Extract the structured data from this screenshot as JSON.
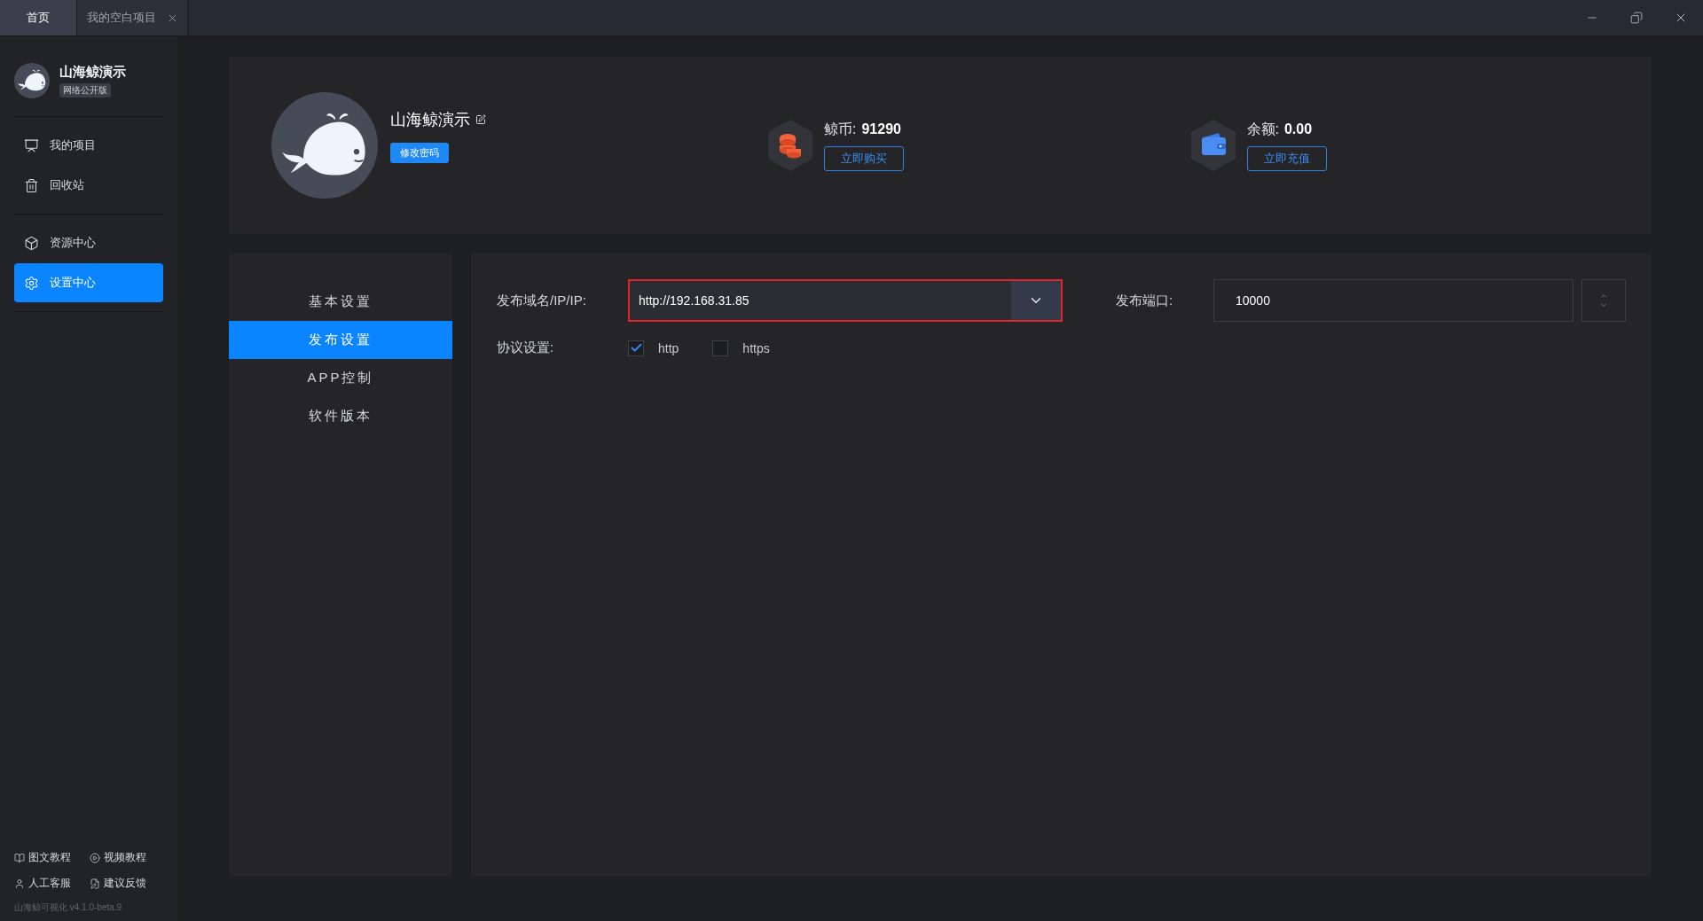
{
  "tabs": [
    {
      "label": "首页",
      "selected": true,
      "closable": false
    },
    {
      "label": "我的空白项目",
      "selected": false,
      "closable": true
    }
  ],
  "sidebar": {
    "brand": {
      "name": "山海鲸演示",
      "edition": "网络公开版"
    },
    "groups": [
      [
        {
          "kind": "projects",
          "label": "我的项目",
          "selected": false
        },
        {
          "kind": "trash",
          "label": "回收站",
          "selected": false
        }
      ],
      [
        {
          "kind": "resources",
          "label": "资源中心",
          "selected": false
        },
        {
          "kind": "settings",
          "label": "设置中心",
          "selected": true
        }
      ]
    ],
    "footer_links": [
      {
        "kind": "doc",
        "label": "图文教程"
      },
      {
        "kind": "video",
        "label": "视频教程"
      },
      {
        "kind": "person",
        "label": "人工客服"
      },
      {
        "kind": "feedback",
        "label": "建议反馈"
      }
    ],
    "version": "山海鲸可视化 v4.1.0-beta.9"
  },
  "profile": {
    "name": "山海鲸演示",
    "change_password": "修改密码",
    "stats": [
      {
        "kind": "coins",
        "label": "鲸币:",
        "value": "91290",
        "button": "立即购买"
      },
      {
        "kind": "wallet",
        "label": "余额:",
        "value": "0.00",
        "button": "立即充值"
      }
    ]
  },
  "settings_nav": [
    {
      "label": "基本设置",
      "selected": false
    },
    {
      "label": "发布设置",
      "selected": true
    },
    {
      "label": "APP控制",
      "selected": false
    },
    {
      "label": "软件版本",
      "selected": false
    }
  ],
  "form": {
    "domain": {
      "label": "发布域名/IP/IP:",
      "value": "http://192.168.31.85",
      "focused": true
    },
    "port": {
      "label": "发布端口:",
      "value": "10000"
    },
    "protocols": {
      "label": "协议设置:",
      "options": [
        {
          "label": "http",
          "checked": true
        },
        {
          "label": "https",
          "checked": false
        }
      ]
    }
  }
}
